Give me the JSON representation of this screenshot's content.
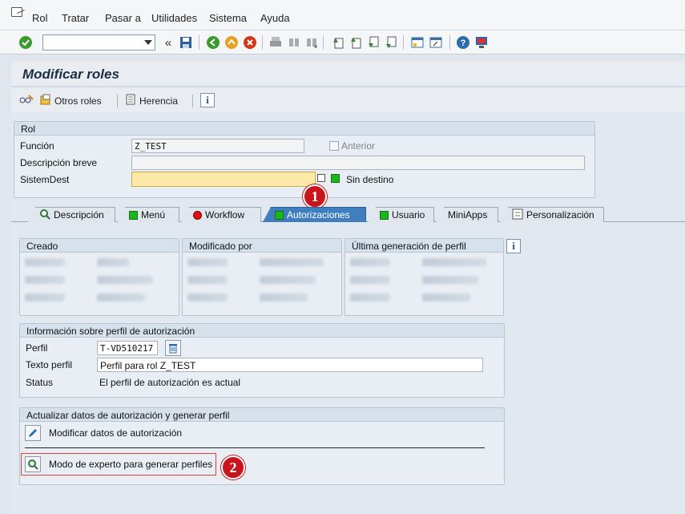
{
  "menu": {
    "items": [
      "Rol",
      "Tratar",
      "Pasar a",
      "Utilidades",
      "Sistema",
      "Ayuda"
    ]
  },
  "toolbar": {
    "command_value": ""
  },
  "title": "Modificar roles",
  "app_toolbar": {
    "other_roles": "Otros roles",
    "inheritance": "Herencia"
  },
  "rol_group": {
    "title": "Rol",
    "funcion_label": "Función",
    "funcion_value": "Z_TEST",
    "anterior_label": "Anterior",
    "descripcion_label": "Descripción breve",
    "descripcion_value": "",
    "sistemdest_label": "SistemDest",
    "sistemdest_value": "",
    "sin_destino_label": "Sin destino"
  },
  "tabs": [
    {
      "label": "Descripción",
      "status": "none"
    },
    {
      "label": "Menú",
      "status": "green"
    },
    {
      "label": "Workflow",
      "status": "red"
    },
    {
      "label": "Autorizaciones",
      "status": "green",
      "active": true
    },
    {
      "label": "Usuario",
      "status": "green"
    },
    {
      "label": "MiniApps",
      "status": "none"
    },
    {
      "label": "Personalización",
      "status": "none"
    }
  ],
  "meta_groups": {
    "creado": "Creado",
    "modificado": "Modificado por",
    "ultima": "Última generación de perfil"
  },
  "perfil_group": {
    "title": "Información sobre perfil de autorización",
    "perfil_label": "Perfil",
    "perfil_value": "T-VD510217",
    "texto_label": "Texto perfil",
    "texto_value": "Perfil para rol Z_TEST",
    "status_label": "Status",
    "status_value": "El perfil de autorización es actual"
  },
  "actualizar_group": {
    "title": "Actualizar datos de autorización y generar perfil",
    "modificar_label": "Modificar datos de autorización",
    "experto_label": "Modo de experto para generar perfiles"
  },
  "badges": {
    "one": "1",
    "two": "2"
  },
  "colors": {
    "active_tab": "#3f7fbf",
    "status_green": "#18b818",
    "badge_red": "#c8141a",
    "required_field": "#fdeaa8"
  }
}
